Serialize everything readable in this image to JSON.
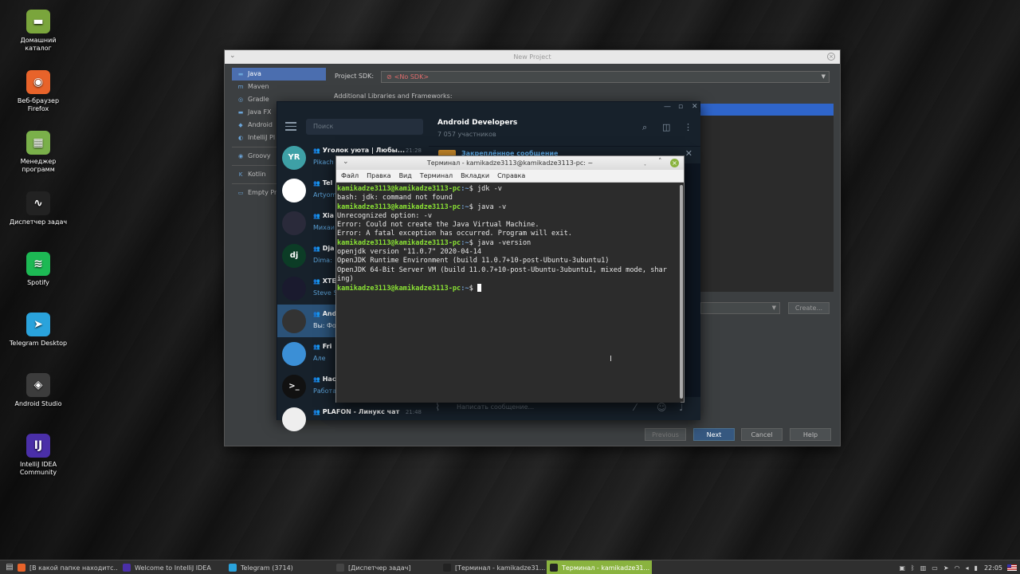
{
  "desktop_icons": [
    {
      "label": "Домашний каталог",
      "icon": "folder-icon",
      "color": "#7aa53c",
      "glyph": "▬"
    },
    {
      "label": "Веб-браузер Firefox",
      "icon": "firefox-icon",
      "color": "#e8632a",
      "glyph": "◉"
    },
    {
      "label": "Менеджер программ",
      "icon": "software-manager-icon",
      "color": "#7ab04a",
      "glyph": "▦"
    },
    {
      "label": "Диспетчер задач",
      "icon": "task-manager-icon",
      "color": "#222222",
      "glyph": "∿"
    },
    {
      "label": "Spotify",
      "icon": "spotify-icon",
      "color": "#1db954",
      "glyph": "≋"
    },
    {
      "label": "Telegram Desktop",
      "icon": "telegram-icon",
      "color": "#2aa3dc",
      "glyph": "➤"
    },
    {
      "label": "Android Studio",
      "icon": "android-studio-icon",
      "color": "#3c3c3c",
      "glyph": "◈"
    },
    {
      "label": "IntelliJ IDEA Community",
      "icon": "intellij-icon",
      "color": "#4a2fa8",
      "glyph": "IJ"
    }
  ],
  "intellij": {
    "title": "New Project",
    "sidebar": [
      {
        "label": "Java",
        "selected": true,
        "icon": "java-folder-icon"
      },
      {
        "label": "Maven",
        "icon": "maven-icon"
      },
      {
        "label": "Gradle",
        "icon": "gradle-icon"
      },
      {
        "label": "Java FX",
        "icon": "javafx-icon"
      },
      {
        "label": "Android",
        "icon": "android-icon"
      },
      {
        "label": "IntelliJ Pl",
        "icon": "intellij-platform-icon"
      },
      {
        "label": "Groovy",
        "icon": "groovy-icon"
      },
      {
        "label": "Kotlin",
        "icon": "kotlin-icon"
      },
      {
        "label": "Empty Pr",
        "icon": "empty-project-icon"
      }
    ],
    "sdk_label": "Project SDK:",
    "sdk_value": "<No SDK>",
    "libs_label": "Additional Libraries and Frameworks:",
    "create_label": "Create...",
    "buttons": {
      "previous": "Previous",
      "next": "Next",
      "cancel": "Cancel",
      "help": "Help"
    }
  },
  "telegram": {
    "search_placeholder": "Поиск",
    "chats": [
      {
        "name": "Уголок уюта | Любы...",
        "preview": "Pikach",
        "time": "21:28",
        "avatar_text": "YR",
        "avatar_color": "#3ea0a6",
        "group": true
      },
      {
        "name": "Tel",
        "preview": "Artyom",
        "time": "",
        "avatar_text": "",
        "avatar_color": "#ffffff",
        "group": true
      },
      {
        "name": "Xia",
        "preview": "Михаи",
        "time": "",
        "avatar_text": "",
        "avatar_color": "#2a2a3a",
        "group": true
      },
      {
        "name": "Dja",
        "preview": "Dima:",
        "time": "",
        "avatar_text": "dj",
        "avatar_color": "#0c3c26",
        "group": true
      },
      {
        "name": "XTE",
        "preview": "Steve S",
        "time": "",
        "avatar_text": "",
        "avatar_color": "#1a1a2e",
        "group": true
      },
      {
        "name": "And",
        "preview": "Вы: Фо",
        "time": "",
        "avatar_text": "",
        "avatar_color": "#333333",
        "group": true,
        "active": true
      },
      {
        "name": "Fri",
        "preview": "Але",
        "time": "",
        "avatar_text": "",
        "avatar_color": "#3b8fd6",
        "group": true
      },
      {
        "name": "Нас",
        "preview": "Работа",
        "time": "",
        "avatar_text": ">_",
        "avatar_color": "#111111",
        "group": true
      },
      {
        "name": "PLAFON - Линукс чат",
        "preview": "",
        "time": "21:48",
        "avatar_text": "",
        "avatar_color": "#eeeeee",
        "group": true
      }
    ],
    "header_name": "Android Developers",
    "header_members": "7 057 участников",
    "pinned_label": "Закреплённое сообщение",
    "message_placeholder": "Написать сообщение..."
  },
  "terminal": {
    "title": "Терминал - kamikadze3113@kamikadze3113-pc: ~",
    "menu": [
      "Файл",
      "Правка",
      "Вид",
      "Терминал",
      "Вкладки",
      "Справка"
    ],
    "prompt_user": "kamikadze3113@kamikadze3113-pc",
    "prompt_path": ":~",
    "prompt_suffix": "$ ",
    "lines": [
      {
        "type": "cmd",
        "text": "jdk -v"
      },
      {
        "type": "out",
        "text": "bash: jdk: command not found"
      },
      {
        "type": "cmd",
        "text": "java -v"
      },
      {
        "type": "out",
        "text": "Unrecognized option: -v"
      },
      {
        "type": "out",
        "text": "Error: Could not create the Java Virtual Machine."
      },
      {
        "type": "out",
        "text": "Error: A fatal exception has occurred. Program will exit."
      },
      {
        "type": "cmd",
        "text": "java -version"
      },
      {
        "type": "out",
        "text": "openjdk version \"11.0.7\" 2020-04-14"
      },
      {
        "type": "out",
        "text": "OpenJDK Runtime Environment (build 11.0.7+10-post-Ubuntu-3ubuntu1)"
      },
      {
        "type": "out",
        "text": "OpenJDK 64-Bit Server VM (build 11.0.7+10-post-Ubuntu-3ubuntu1, mixed mode, shar"
      },
      {
        "type": "out",
        "text": "ing)"
      },
      {
        "type": "cmd",
        "text": "",
        "cursor": true
      }
    ]
  },
  "taskbar": {
    "tasks": [
      {
        "label": "[В какой папке находитс...",
        "icon": "firefox-task-icon",
        "color": "#e8632a"
      },
      {
        "label": "Welcome to IntelliJ IDEA",
        "icon": "intellij-task-icon",
        "color": "#4a2fa8"
      },
      {
        "label": "Telegram (3714)",
        "icon": "telegram-task-icon",
        "color": "#2aa3dc"
      },
      {
        "label": "[Диспетчер задач]",
        "icon": "task-manager-task-icon",
        "color": "#444444"
      },
      {
        "label": "[Терминал - kamikadze31...",
        "icon": "terminal-task-icon",
        "color": "#222222"
      },
      {
        "label": "Терминал - kamikadze31...",
        "icon": "terminal-task-icon",
        "color": "#222222",
        "active": true
      }
    ],
    "clock": "22:05"
  }
}
